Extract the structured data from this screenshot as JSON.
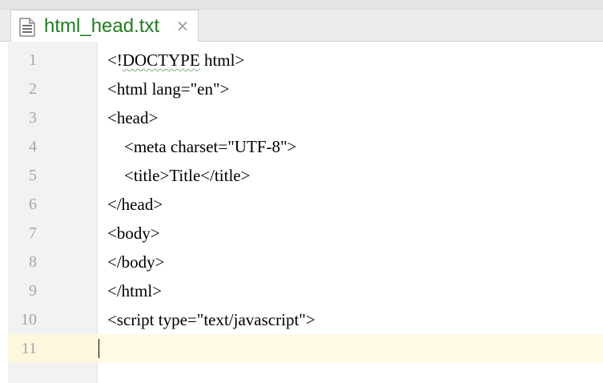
{
  "tab": {
    "title": "html_head.txt",
    "close_glyph": "×",
    "icon": "text-file-icon"
  },
  "editor": {
    "line_numbers": [
      "1",
      "2",
      "3",
      "4",
      "5",
      "6",
      "7",
      "8",
      "9",
      "10",
      "11"
    ],
    "current_line": 11,
    "lines": [
      {
        "pre": "<!",
        "squiggle": "DOCTYPE",
        "post": " html>"
      },
      {
        "pre": "<html lang=\"en\">",
        "squiggle": "",
        "post": ""
      },
      {
        "pre": "<head>",
        "squiggle": "",
        "post": ""
      },
      {
        "pre": "    <meta charset=\"UTF-8\">",
        "squiggle": "",
        "post": ""
      },
      {
        "pre": "    <title>Title</title>",
        "squiggle": "",
        "post": ""
      },
      {
        "pre": "</head>",
        "squiggle": "",
        "post": ""
      },
      {
        "pre": "<body>",
        "squiggle": "",
        "post": ""
      },
      {
        "pre": "</body>",
        "squiggle": "",
        "post": ""
      },
      {
        "pre": "</html>",
        "squiggle": "",
        "post": ""
      },
      {
        "pre": "<script type=\"text/javascript\">",
        "squiggle": "",
        "post": ""
      },
      {
        "pre": "",
        "squiggle": "",
        "post": ""
      }
    ]
  },
  "colors": {
    "tab_title": "#1e7d1e",
    "line_number": "#a6a6a6",
    "current_line_bg": "#fffae3",
    "gutter_bg": "#f2f2f2"
  }
}
